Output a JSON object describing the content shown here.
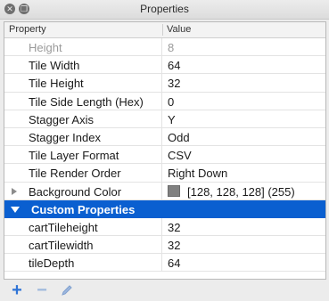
{
  "window": {
    "title": "Properties"
  },
  "table": {
    "headers": {
      "property": "Property",
      "value": "Value"
    },
    "rows": [
      {
        "label": "Height",
        "value": "8",
        "dim": true
      },
      {
        "label": "Tile Width",
        "value": "64"
      },
      {
        "label": "Tile Height",
        "value": "32"
      },
      {
        "label": "Tile Side Length (Hex)",
        "value": "0"
      },
      {
        "label": "Stagger Axis",
        "value": "Y"
      },
      {
        "label": "Stagger Index",
        "value": "Odd"
      },
      {
        "label": "Tile Layer Format",
        "value": "CSV"
      },
      {
        "label": "Tile Render Order",
        "value": "Right Down"
      },
      {
        "label": "Background Color",
        "value": "[128, 128, 128] (255)",
        "swatch": "#808080",
        "expandable": true
      }
    ],
    "custom_group": {
      "label": "Custom Properties"
    },
    "custom_rows": [
      {
        "label": "cartTileheight",
        "value": "32"
      },
      {
        "label": "cartTilewidth",
        "value": "32"
      },
      {
        "label": "tileDepth",
        "value": "64"
      }
    ]
  },
  "toolbar": {
    "add_icon": "plus-icon",
    "remove_icon": "minus-icon",
    "rename_icon": "pencil-icon"
  },
  "colors": {
    "selection": "#0a5fd0",
    "accent": "#2f74d6"
  }
}
